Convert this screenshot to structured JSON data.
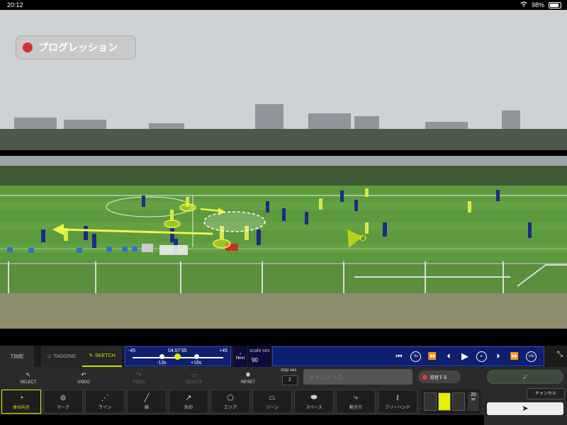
{
  "status_bar": {
    "time": "20:12",
    "wifi_icon": "wifi-icon",
    "battery": "98%"
  },
  "video": {
    "recording_label": "プログレッション"
  },
  "mode_tabs": {
    "time": "TIME",
    "tagging": "TAGGING",
    "sketch": "SKETCH",
    "active": "sketch"
  },
  "timeline": {
    "min": "-45",
    "current": "04:07'35",
    "max": "+45",
    "left_offset": "-13s",
    "right_offset": "+16s"
  },
  "next_label": "Next",
  "scale": {
    "label": "scale sec",
    "value": "90"
  },
  "transport": {
    "rewind_5": "-5s",
    "forward_5": "+5s"
  },
  "edit_tools": [
    {
      "label": "SELECT",
      "icon": "cursor-icon",
      "enabled": true
    },
    {
      "label": "UNDO",
      "icon": "undo-icon",
      "enabled": true
    },
    {
      "label": "REDO",
      "icon": "redo-icon",
      "enabled": false
    },
    {
      "label": "DELETE",
      "icon": "trash-icon",
      "enabled": false
    },
    {
      "label": "RESET",
      "icon": "reset-icon",
      "enabled": true
    }
  ],
  "stop": {
    "label": "stop sec",
    "value": "2"
  },
  "text_input": {
    "placeholder": "テキスト入力"
  },
  "record_button": {
    "label": "録音する"
  },
  "draw_tools": [
    {
      "label": "体の向き",
      "icon": "body-direction-icon",
      "active": true
    },
    {
      "label": "マーク",
      "icon": "mark-icon",
      "active": false
    },
    {
      "label": "ライン",
      "icon": "line-connect-icon",
      "active": false
    },
    {
      "label": "線",
      "icon": "line-icon",
      "active": false
    },
    {
      "label": "矢印",
      "icon": "arrow-icon",
      "active": false
    },
    {
      "label": "エリア",
      "icon": "area-icon",
      "active": false
    },
    {
      "label": "ゾーン",
      "icon": "zone-icon",
      "active": false
    },
    {
      "label": "スペース",
      "icon": "space-icon",
      "active": false
    },
    {
      "label": "動き方",
      "icon": "movement-icon",
      "active": false
    },
    {
      "label": "フリーハンド",
      "icon": "freehand-icon",
      "active": false
    }
  ],
  "properties": {
    "stroke_width": "20",
    "unit": "px",
    "color": "#e8f000"
  },
  "actions": {
    "cancel": "キャンセル"
  },
  "colors": {
    "accent": "#e8f000",
    "timeline_bg": "#0d1f6e",
    "record": "#d32f2f"
  }
}
